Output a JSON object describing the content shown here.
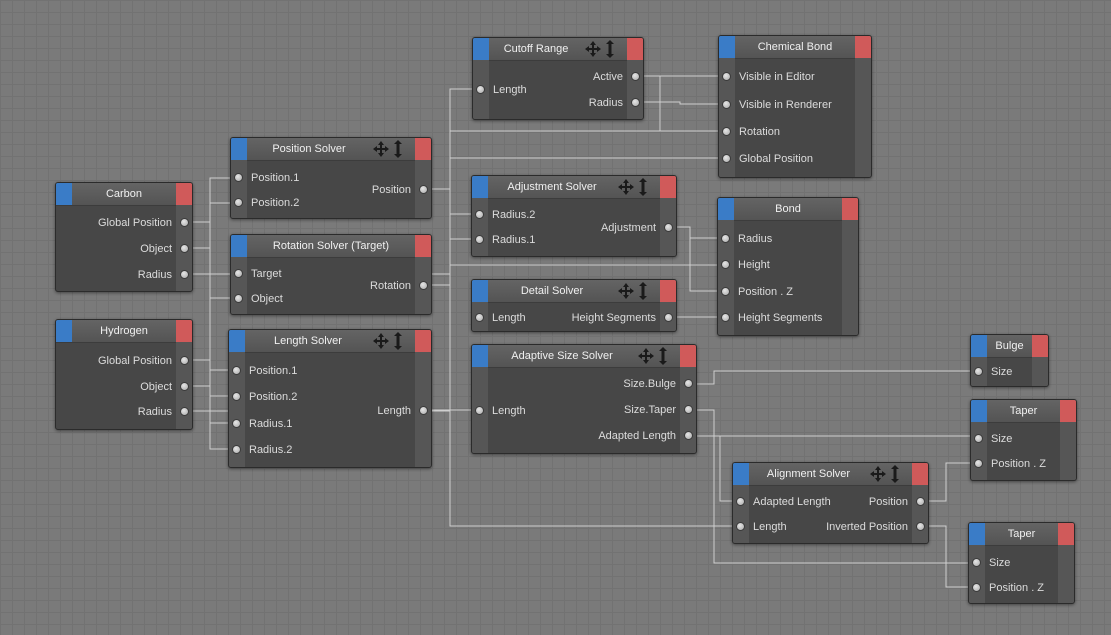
{
  "nodes": {
    "carbon": {
      "title": "Carbon",
      "outputs": [
        "Global Position",
        "Object",
        "Radius"
      ]
    },
    "hydrogen": {
      "title": "Hydrogen",
      "outputs": [
        "Global Position",
        "Object",
        "Radius"
      ]
    },
    "position_solver": {
      "title": "Position Solver",
      "inputs": [
        "Position.1",
        "Position.2"
      ],
      "outputs": [
        "Position"
      ]
    },
    "rotation_solver": {
      "title": "Rotation Solver (Target)",
      "inputs": [
        "Target",
        "Object"
      ],
      "outputs": [
        "Rotation"
      ]
    },
    "length_solver": {
      "title": "Length Solver",
      "inputs": [
        "Position.1",
        "Position.2",
        "Radius.1",
        "Radius.2"
      ],
      "outputs": [
        "Length"
      ]
    },
    "cutoff_range": {
      "title": "Cutoff Range",
      "inputs": [
        "Length"
      ],
      "outputs": [
        "Active",
        "Radius"
      ]
    },
    "adjustment_solver": {
      "title": "Adjustment Solver",
      "inputs": [
        "Radius.2",
        "Radius.1"
      ],
      "outputs": [
        "Adjustment"
      ]
    },
    "detail_solver": {
      "title": "Detail Solver",
      "inputs": [
        "Length"
      ],
      "outputs": [
        "Height Segments"
      ]
    },
    "adaptive_size_solver": {
      "title": "Adaptive Size Solver",
      "inputs": [
        "Length"
      ],
      "outputs": [
        "Size.Bulge",
        "Size.Taper",
        "Adapted Length"
      ]
    },
    "chemical_bond": {
      "title": "Chemical Bond",
      "inputs": [
        "Visible in Editor",
        "Visible in Renderer",
        "Rotation",
        "Global Position"
      ]
    },
    "bond": {
      "title": "Bond",
      "inputs": [
        "Radius",
        "Height",
        "Position . Z",
        "Height Segments"
      ]
    },
    "bulge": {
      "title": "Bulge",
      "inputs": [
        "Size"
      ]
    },
    "taper1": {
      "title": "Taper",
      "inputs": [
        "Size",
        "Position . Z"
      ]
    },
    "alignment_solver": {
      "title": "Alignment Solver",
      "inputs": [
        "Adapted Length",
        "Length"
      ],
      "outputs": [
        "Position",
        "Inverted Position"
      ]
    },
    "taper2": {
      "title": "Taper",
      "inputs": [
        "Size",
        "Position . Z"
      ]
    }
  },
  "icons": {
    "input_tab": "input-port-tab-icon",
    "output_tab": "output-port-tab-icon",
    "tools": "move-arrows-icon",
    "port": "port-dot-icon"
  },
  "colors": {
    "input_tab": "#3a7cc7",
    "output_tab": "#d05a5a",
    "background": "#7a7a7a",
    "node_body": "#474747",
    "wire": "#cfcfcf"
  }
}
